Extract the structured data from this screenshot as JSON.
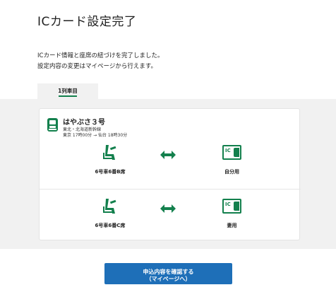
{
  "page": {
    "title": "ICカード設定完了",
    "message_line1": "ICカード情報と座席の紐づけを完了しました。",
    "message_line2": "設定内容の変更はマイページから行えます。"
  },
  "tab": {
    "label": "1列車目"
  },
  "train": {
    "name": "はやぶさ３号",
    "line": "東北・北海道新幹線",
    "schedule": "東京 17時00分 → 仙台 18時30分"
  },
  "rows": [
    {
      "seat": "6号車6番B席",
      "ic_label": "自分用",
      "ic_text": "IC"
    },
    {
      "seat": "6号車6番C席",
      "ic_label": "妻用",
      "ic_text": "IC"
    }
  ],
  "button": {
    "label": "申込内容を確認する\n（マイページへ）"
  },
  "colors": {
    "brand_green": "#13804d",
    "button_blue": "#1e6fb8",
    "band_gray": "#f1f1f1"
  },
  "icons": {
    "train": "train-icon",
    "seat": "seat-icon",
    "link": "double-arrow-icon",
    "card": "ic-card-icon"
  }
}
